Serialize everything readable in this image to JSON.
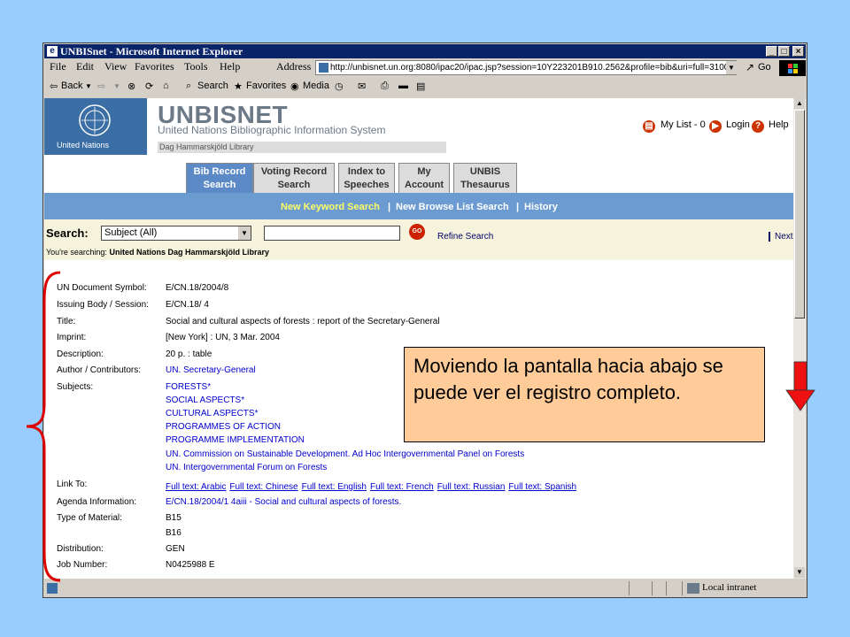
{
  "window": {
    "title": "UNBISnet - Microsoft Internet Explorer",
    "minimize": "_",
    "maximize": "□",
    "close": "×"
  },
  "menu": [
    "File",
    "Edit",
    "View",
    "Favorites",
    "Tools",
    "Help"
  ],
  "address": {
    "label": "Address",
    "url": "http://unbisnet.un.org:8080/ipac20/ipac.jsp?session=10Y223201B910.2562&profile=bib&uri=full=3100001@!73",
    "go_label": "Go"
  },
  "toolbar": {
    "back": "Back",
    "search": "Search",
    "favorites": "Favorites",
    "media": "Media"
  },
  "header": {
    "un_label": "United Nations",
    "brand": "UNBISNET",
    "subtitle": "United Nations Bibliographic Information System",
    "library": "Dag Hammarskjöld Library",
    "my_list": "My List - 0",
    "login": "Login",
    "help": "Help"
  },
  "tabs": [
    {
      "line1": "Bib Record",
      "line2": "Search"
    },
    {
      "line1": "Voting Record",
      "line2": "Search"
    },
    {
      "line1": "Index to",
      "line2": "Speeches"
    },
    {
      "line1": "My",
      "line2": "Account"
    },
    {
      "line1": "UNBIS",
      "line2": "Thesaurus"
    }
  ],
  "subnav": [
    "New Keyword Search",
    "New Browse List Search",
    "History"
  ],
  "search": {
    "label": "Search:",
    "scope": "Subject (All)",
    "query": "",
    "go": "GO",
    "refine": "Refine Search",
    "next": "Next",
    "searching_prefix": "You're searching:",
    "searching_target": "United Nations Dag Hammarskjöld Library"
  },
  "record": {
    "symbol_label": "UN Document Symbol:",
    "symbol": "E/CN.18/2004/8",
    "body_label": "Issuing Body / Session:",
    "body": "E/CN.18/ 4",
    "title_label": "Title:",
    "title": "Social and cultural aspects of forests : report of the Secretary-General",
    "imprint_label": "Imprint:",
    "imprint": "[New York] : UN, 3 Mar. 2004",
    "description_label": "Description:",
    "description": "20 p. : table",
    "author_label": "Author / Contributors:",
    "author": "UN. Secretary-General",
    "subjects_label": "Subjects:",
    "subjects": [
      "FORESTS*",
      "SOCIAL ASPECTS*",
      "CULTURAL ASPECTS*",
      "PROGRAMMES OF ACTION",
      "PROGRAMME IMPLEMENTATION",
      "UN. Commission on Sustainable Development. Ad Hoc Intergovernmental Panel on Forests",
      "UN. Intergovernmental Forum on Forests"
    ],
    "link_label": "Link To:",
    "links": [
      "Full text: Arabic",
      "Full text: Chinese",
      "Full text: English",
      "Full text: French",
      "Full text: Russian",
      "Full text: Spanish"
    ],
    "agenda_label": "Agenda Information:",
    "agenda": "E/CN.18/2004/1 4aiii - Social and cultural aspects of forests.",
    "material_label": "Type of Material:",
    "material1": "B15",
    "material2": "B16",
    "distribution_label": "Distribution:",
    "distribution": "GEN",
    "job_label": "Job Number:",
    "job": "N0425988 E"
  },
  "status": {
    "zone": "Local intranet"
  },
  "callout": {
    "text": "Moviendo la pantalla hacia abajo se puede ver el registro completo."
  },
  "colors": {
    "accent": "#6b9bd1",
    "callout_bg": "#ffcc99",
    "arrow": "#ee1111",
    "brace": "#dd0000"
  }
}
